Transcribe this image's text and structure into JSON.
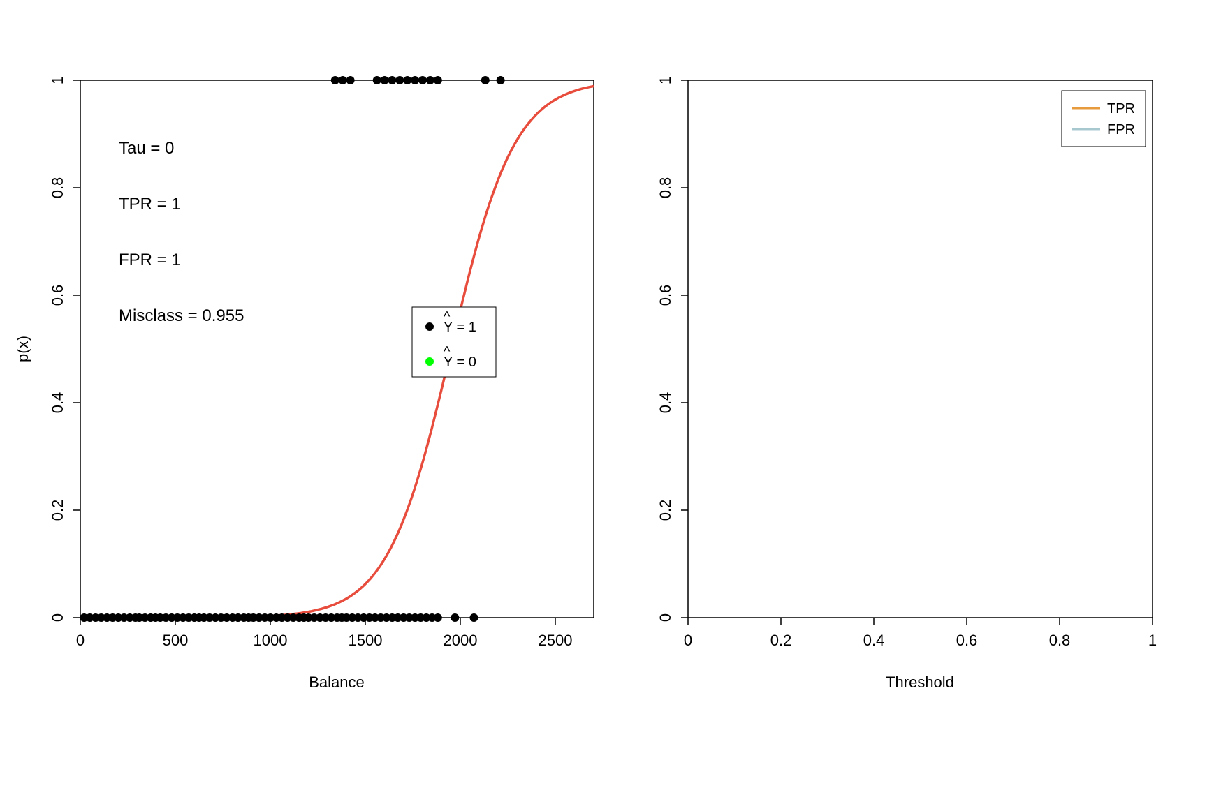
{
  "chart_data": [
    {
      "type": "scatter_with_curve",
      "xlabel": "Balance",
      "ylabel": "p(x)",
      "xlim": [
        0,
        2700
      ],
      "ylim": [
        0,
        1.0
      ],
      "xticks": [
        0,
        500,
        1000,
        1500,
        2000,
        2500
      ],
      "yticks": [
        0.0,
        0.2,
        0.4,
        0.6,
        0.8,
        1.0
      ],
      "annotations": {
        "tau": "Tau = 0",
        "tpr": "TPR = 1",
        "fpr": "FPR = 1",
        "misclass": "Misclass = 0.955"
      },
      "legend": [
        {
          "label": "Ŷ = 1",
          "marker": "point",
          "color": "#000000"
        },
        {
          "label": "Ŷ = 0",
          "marker": "point",
          "color": "#00FF00"
        }
      ],
      "logistic_curve": {
        "color": "#E74C3C",
        "midpoint": 1950,
        "steepness": 0.006
      },
      "points_y0_black": [
        20,
        50,
        80,
        110,
        140,
        170,
        200,
        230,
        260,
        290,
        310,
        340,
        370,
        395,
        420,
        450,
        480,
        510,
        540,
        570,
        600,
        625,
        650,
        680,
        710,
        740,
        770,
        800,
        830,
        860,
        885,
        910,
        940,
        970,
        1000,
        1030,
        1060,
        1090,
        1120,
        1150,
        1175,
        1200,
        1230,
        1260,
        1290,
        1320,
        1350,
        1375,
        1400,
        1430,
        1460,
        1490,
        1520,
        1550,
        1580,
        1610,
        1640,
        1670,
        1700,
        1730,
        1760,
        1790,
        1820,
        1850,
        1880,
        1970,
        2070
      ],
      "points_y1_black": [
        1340,
        1380,
        1420,
        1560,
        1600,
        1640,
        1680,
        1720,
        1760,
        1800,
        1840,
        1880,
        2130,
        2210
      ]
    },
    {
      "type": "line",
      "xlabel": "Threshold",
      "ylabel": "",
      "xlim": [
        0,
        1.0
      ],
      "ylim": [
        0,
        1.0
      ],
      "xticks": [
        0.0,
        0.2,
        0.4,
        0.6,
        0.8,
        1.0
      ],
      "yticks": [
        0.0,
        0.2,
        0.4,
        0.6,
        0.8,
        1.0
      ],
      "legend": [
        {
          "label": "TPR",
          "marker": "line",
          "color": "#E89B3D"
        },
        {
          "label": "FPR",
          "marker": "line",
          "color": "#A8C8D0"
        }
      ],
      "series": []
    }
  ]
}
